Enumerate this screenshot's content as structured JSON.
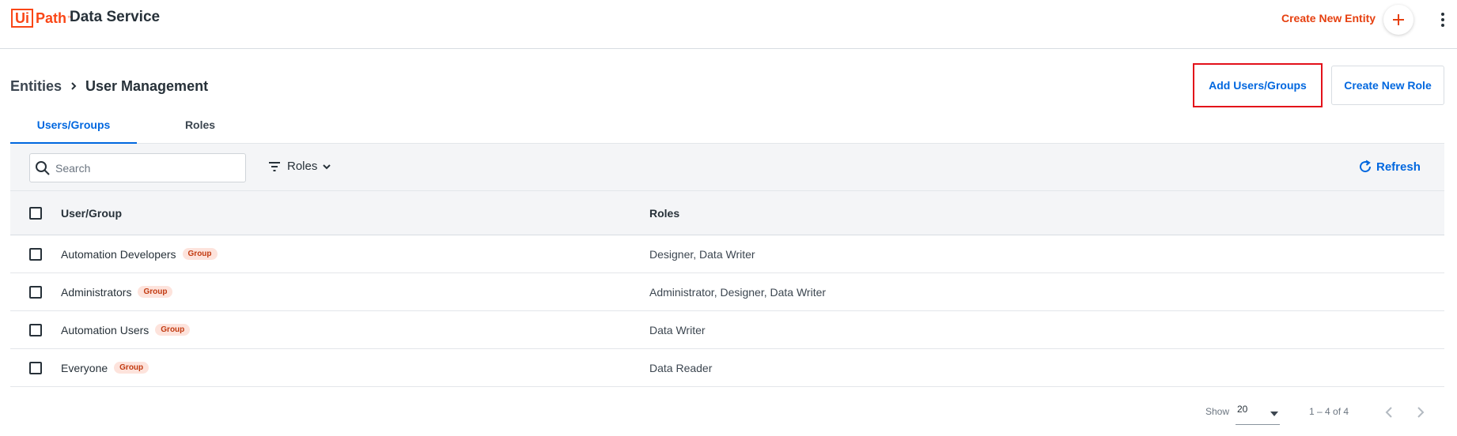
{
  "header": {
    "logo_text_ui": "Ui",
    "logo_text_path": "Path",
    "logo_tm": "™",
    "app_title": "Data Service",
    "create_entity_label": "Create New Entity",
    "accent_color": "#e64010"
  },
  "breadcrumb": {
    "parent": "Entities",
    "current": "User Management"
  },
  "actions": {
    "add_users_label": "Add Users/Groups",
    "create_role_label": "Create New Role"
  },
  "tabs": [
    {
      "label": "Users/Groups",
      "active": true
    },
    {
      "label": "Roles",
      "active": false
    }
  ],
  "toolbar": {
    "search_placeholder": "Search",
    "roles_filter_label": "Roles",
    "refresh_label": "Refresh"
  },
  "table": {
    "columns": [
      "User/Group",
      "Roles"
    ],
    "rows": [
      {
        "name": "Automation Developers",
        "badge": "Group",
        "roles": "Designer, Data Writer"
      },
      {
        "name": "Administrators",
        "badge": "Group",
        "roles": "Administrator, Designer, Data Writer"
      },
      {
        "name": "Automation Users",
        "badge": "Group",
        "roles": "Data Writer"
      },
      {
        "name": "Everyone",
        "badge": "Group",
        "roles": "Data Reader"
      }
    ]
  },
  "paginator": {
    "show_label": "Show",
    "page_size": "20",
    "range_label": "1 – 4 of 4"
  },
  "icons": {
    "plus": "plus-icon",
    "more": "more-vert-icon",
    "search": "search-icon",
    "filter": "filter-icon",
    "refresh": "refresh-icon"
  }
}
